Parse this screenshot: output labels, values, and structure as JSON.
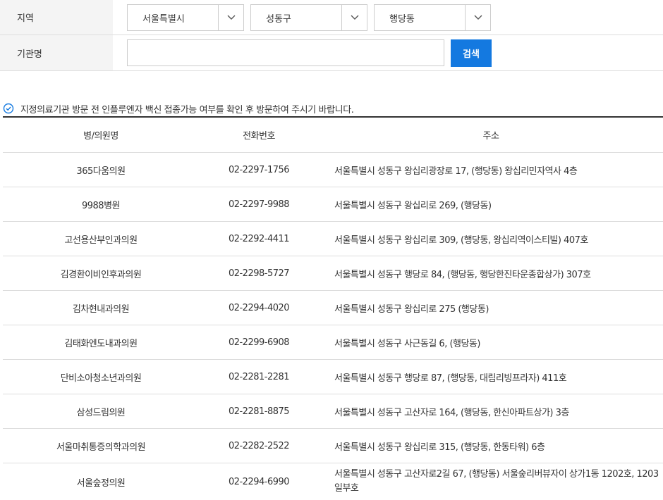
{
  "search": {
    "region_label": "지역",
    "name_label": "기관명",
    "city": "서울특별시",
    "district": "성동구",
    "dong": "행당동",
    "name_value": "",
    "search_button": "검색"
  },
  "notice": "지정의료기관 방문 전 인플루엔자 백신 접종가능 여부를 확인 후 방문하여 주시기 바랍니다.",
  "table": {
    "headers": {
      "name": "병/의원명",
      "phone": "전화번호",
      "address": "주소"
    },
    "rows": [
      {
        "name": "365다움의원",
        "phone": "02-2297-1756",
        "address": "서울특별시 성동구 왕십리광장로 17, (행당동) 왕십리민자역사 4층"
      },
      {
        "name": "9988병원",
        "phone": "02-2297-9988",
        "address": "서울특별시 성동구 왕십리로 269, (행당동)"
      },
      {
        "name": "고선용산부인과의원",
        "phone": "02-2292-4411",
        "address": "서울특별시 성동구 왕십리로 309, (행당동, 왕십리역이스티빌) 407호"
      },
      {
        "name": "김경환이비인후과의원",
        "phone": "02-2298-5727",
        "address": "서울특별시 성동구 행당로 84, (행당동, 행당한진타운종합상가) 307호"
      },
      {
        "name": "김차현내과의원",
        "phone": "02-2294-4020",
        "address": "서울특별시 성동구 왕십리로 275 (행당동)"
      },
      {
        "name": "김태화엔도내과의원",
        "phone": "02-2299-6908",
        "address": "서울특별시 성동구 사근동길 6, (행당동)"
      },
      {
        "name": "단비소아청소년과의원",
        "phone": "02-2281-2281",
        "address": "서울특별시 성동구 행당로 87, (행당동, 대림리빙프라자) 411호"
      },
      {
        "name": "삼성드림의원",
        "phone": "02-2281-8875",
        "address": "서울특별시 성동구 고산자로 164, (행당동, 한신아파트상가) 3층"
      },
      {
        "name": "서울마취통증의학과의원",
        "phone": "02-2282-2522",
        "address": "서울특별시 성동구 왕십리로 315, (행당동, 한동타워) 6층"
      },
      {
        "name": "서울숲정의원",
        "phone": "02-2294-6990",
        "address": "서울특별시 성동구 고산자로2길 67, (행당동) 서울숲리버뷰자이 상가1동 1202호, 1203일부호"
      }
    ]
  },
  "colors": {
    "accent": "#1479e0",
    "header_bg": "#f4f4f4",
    "border": "#dddddd"
  }
}
